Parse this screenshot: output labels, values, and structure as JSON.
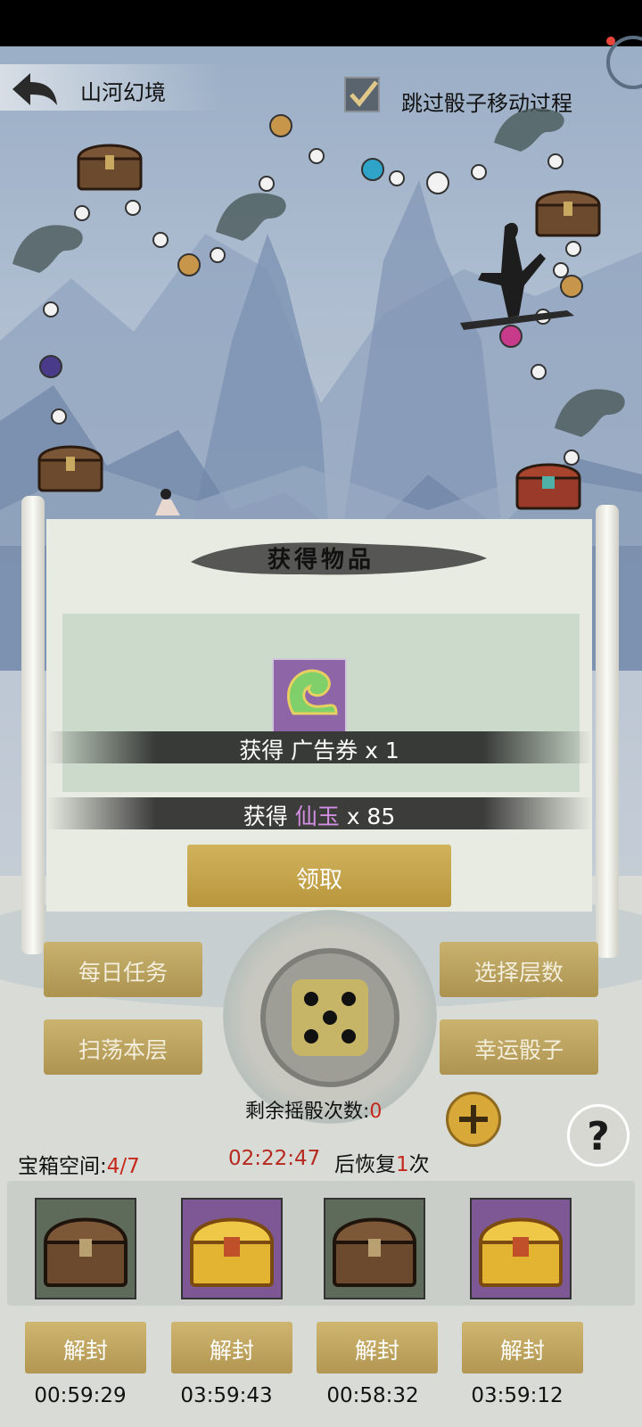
{
  "header": {
    "stage_title": "山河幻境",
    "skip_label": "跳过骰子移动过程",
    "skip_checked": true
  },
  "dialog": {
    "title": "获得物品",
    "reward1_prefix": "获得",
    "reward1_item": "广告券",
    "reward1_qty": "x 1",
    "reward2_prefix": "获得",
    "reward2_item": "仙玉",
    "reward2_qty": "x 85",
    "claim_label": "领取"
  },
  "actions": {
    "daily_tasks": "每日任务",
    "sweep_floor": "扫荡本层",
    "select_floor": "选择层数",
    "lucky_dice": "幸运骰子"
  },
  "dice": {
    "rolls_label": "剩余摇骰次数:",
    "rolls_value": "0",
    "face": 5
  },
  "status": {
    "chest_space_label": "宝箱空间:",
    "chest_space_value": "4/7",
    "countdown": "02:22:47",
    "recover_prefix": "后恢复",
    "recover_count": "1",
    "recover_suffix": "次"
  },
  "chest_slots": [
    {
      "type": "bronze-chest",
      "button": "解封",
      "timer": "00:59:29"
    },
    {
      "type": "gold-chest",
      "button": "解封",
      "timer": "03:59:43"
    },
    {
      "type": "bronze-chest",
      "button": "解封",
      "timer": "00:58:32"
    },
    {
      "type": "gold-chest",
      "button": "解封",
      "timer": "03:59:12"
    }
  ],
  "colors": {
    "gold_button": "#c9ae62",
    "countdown_red": "#b6291f",
    "xianyu_purple": "#d48ee2"
  }
}
